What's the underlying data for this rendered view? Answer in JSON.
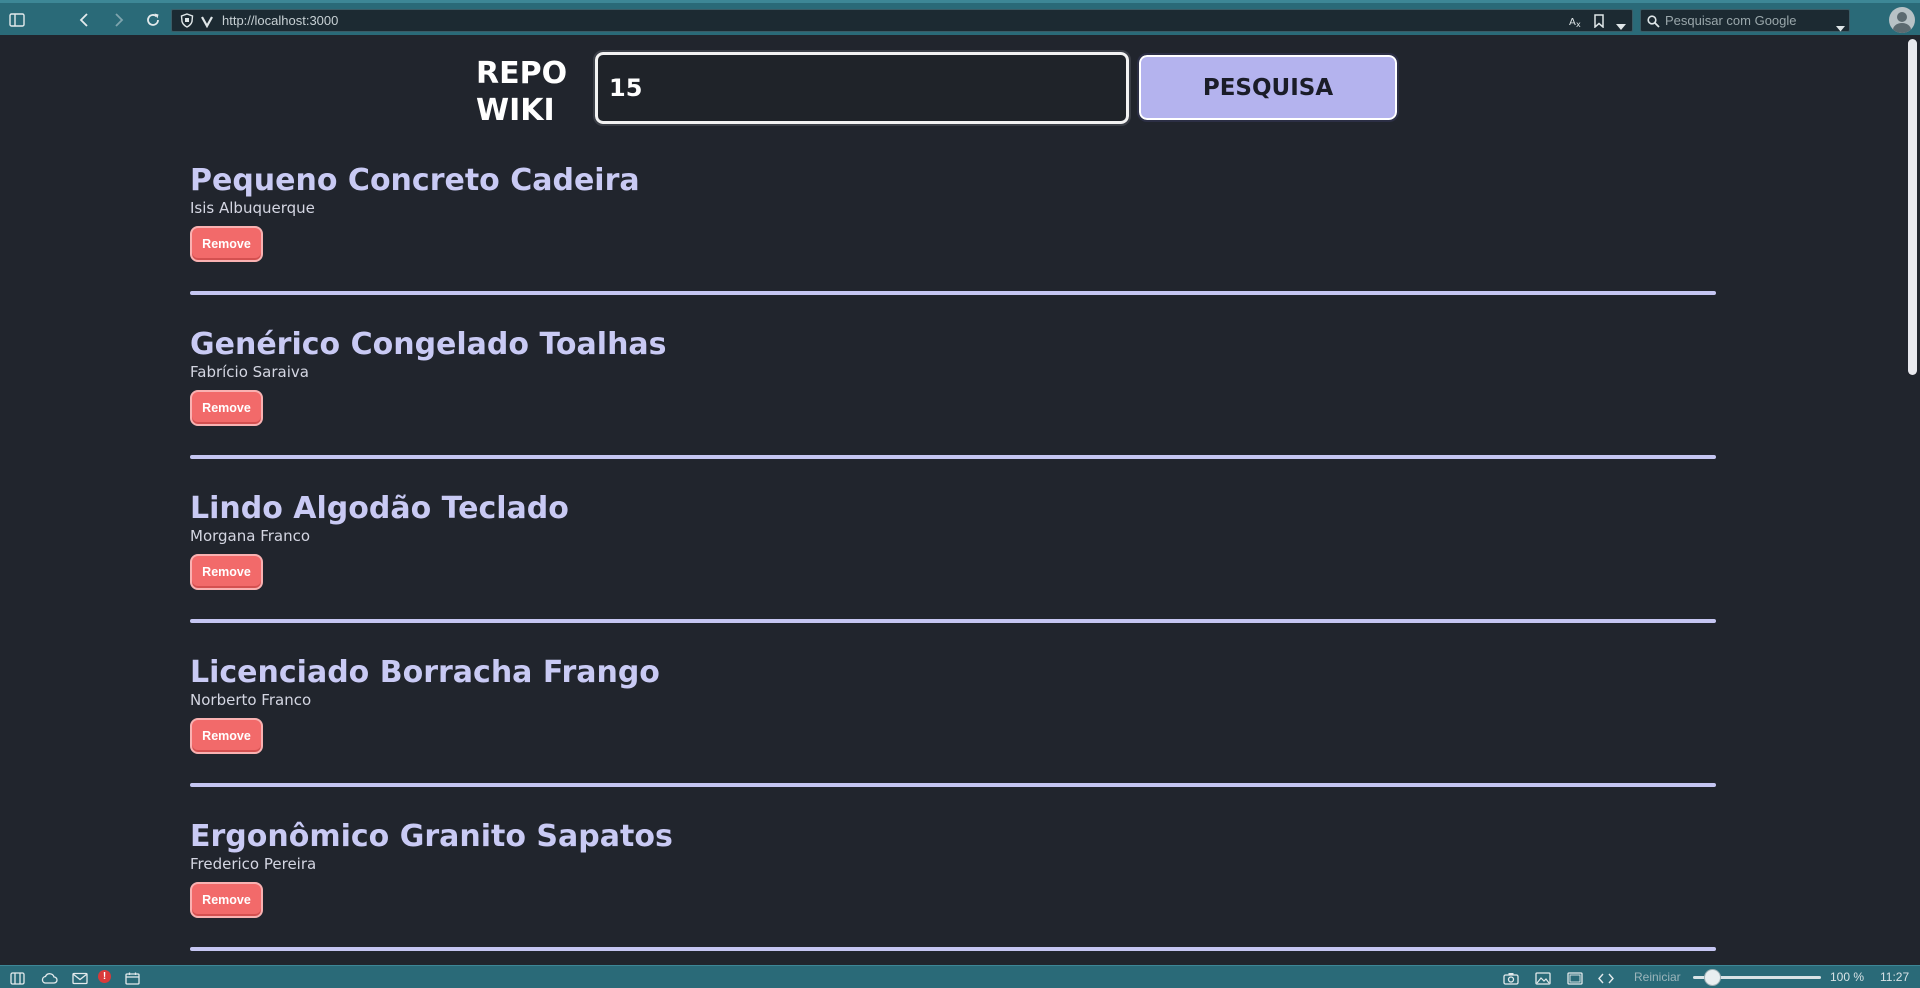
{
  "browser": {
    "url": "http://localhost:3000",
    "search_placeholder": "Pesquisar com Google"
  },
  "header": {
    "logo_line1": "REPO",
    "logo_line2": "WIKI",
    "search_value": "15",
    "search_button": "PESQUISA"
  },
  "items": [
    {
      "title": "Pequeno Concreto Cadeira",
      "author": "Isis Albuquerque",
      "remove": "Remove"
    },
    {
      "title": "Genérico Congelado Toalhas",
      "author": "Fabrício Saraiva",
      "remove": "Remove"
    },
    {
      "title": "Lindo Algodão Teclado",
      "author": "Morgana Franco",
      "remove": "Remove"
    },
    {
      "title": "Licenciado Borracha Frango",
      "author": "Norberto Franco",
      "remove": "Remove"
    },
    {
      "title": "Ergonômico Granito Sapatos",
      "author": "Frederico Pereira",
      "remove": "Remove"
    }
  ],
  "statusbar": {
    "reset_label": "Reiniciar",
    "zoom": "100 %",
    "zoom_level": 0.15,
    "time": "11:27"
  },
  "colors": {
    "page_bg": "#21252d",
    "accent": "#b4b3ee",
    "title": "#c9caf4",
    "remove": "#f26a6a",
    "chrome": "#2a6a78"
  }
}
